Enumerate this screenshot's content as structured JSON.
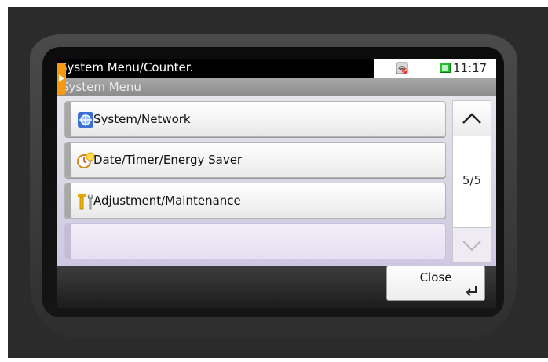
{
  "header": {
    "title": "System Menu/Counter.",
    "subtitle": "System Menu",
    "time": "11:17"
  },
  "icons": {
    "network_status": "network-disconnected-icon",
    "clock": "clock-icon",
    "tab_handle": "expand-arrow-icon"
  },
  "menu": {
    "items": [
      {
        "label": "System/Network",
        "icon": "system-network-icon"
      },
      {
        "label": "Date/Timer/Energy Saver",
        "icon": "date-timer-icon"
      },
      {
        "label": "Adjustment/Maintenance",
        "icon": "adjustment-tools-icon"
      }
    ]
  },
  "pagination": {
    "indicator": "5/5"
  },
  "footer": {
    "close_label": "Close"
  },
  "colors": {
    "accent": "#f59a14",
    "status_ok": "#1fbf2e"
  }
}
